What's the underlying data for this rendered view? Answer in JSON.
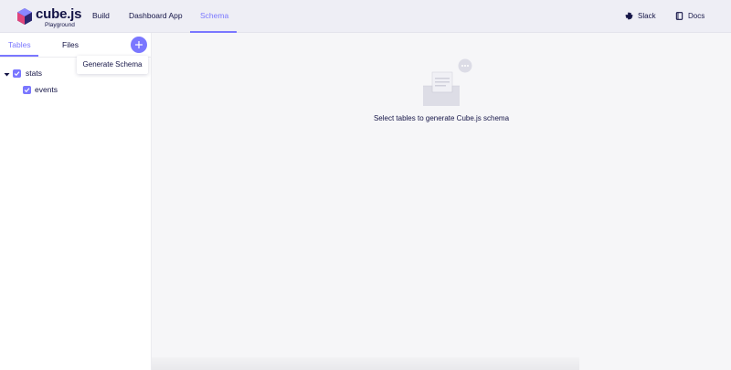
{
  "brand": {
    "name": "cube.js",
    "subtitle": "Playground"
  },
  "nav": {
    "items": [
      {
        "label": "Build"
      },
      {
        "label": "Dashboard App"
      },
      {
        "label": "Schema"
      }
    ]
  },
  "links": {
    "slack": "Slack",
    "docs": "Docs"
  },
  "sidebar": {
    "tabs": [
      {
        "label": "Tables"
      },
      {
        "label": "Files"
      }
    ],
    "tree": {
      "schema": {
        "label": "stats",
        "checked": true
      },
      "tables": [
        {
          "label": "events",
          "checked": true
        }
      ]
    }
  },
  "tooltip": {
    "text": "Generate Schema"
  },
  "main": {
    "empty_text": "Select tables to generate Cube.js schema"
  },
  "colors": {
    "accent": "#7a77ff",
    "text": "#141446",
    "header_bg": "#eeeef5"
  }
}
